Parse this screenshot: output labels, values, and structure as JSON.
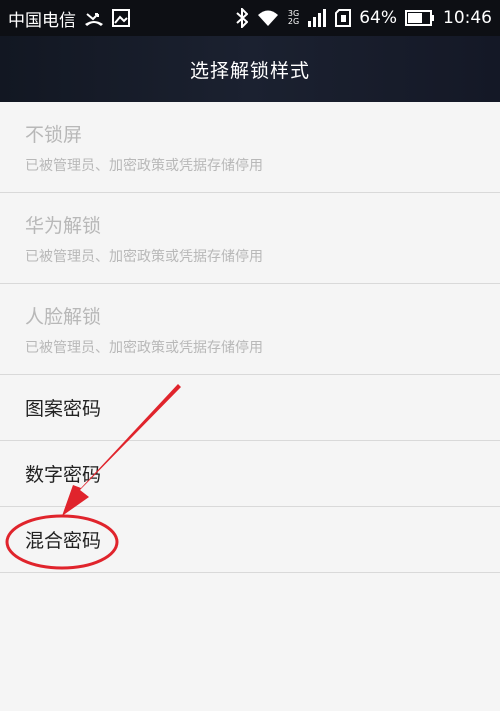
{
  "status_bar": {
    "carrier": "中国电信",
    "network_top": "3G",
    "network_bottom": "2G",
    "battery": "64%",
    "time": "10:46"
  },
  "header": {
    "title": "选择解锁样式"
  },
  "options": [
    {
      "title": "不锁屏",
      "subtitle": "已被管理员、加密政策或凭据存储停用"
    },
    {
      "title": "华为解锁",
      "subtitle": "已被管理员、加密政策或凭据存储停用"
    },
    {
      "title": "人脸解锁",
      "subtitle": "已被管理员、加密政策或凭据存储停用"
    },
    {
      "title": "图案密码"
    },
    {
      "title": "数字密码"
    },
    {
      "title": "混合密码"
    }
  ],
  "colors": {
    "annotation": "#e0242c",
    "status_bg": "#0d0f14",
    "disabled_text": "#b8b8b8"
  }
}
